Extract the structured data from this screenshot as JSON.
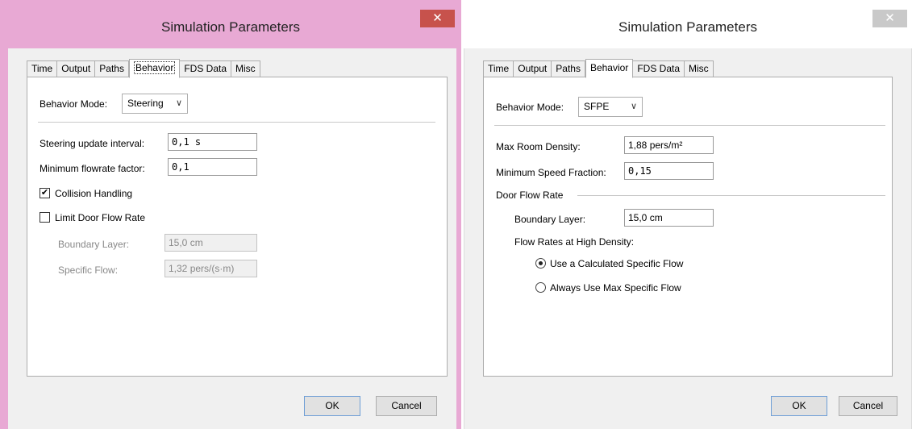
{
  "left_dialog": {
    "title": "Simulation Parameters",
    "close_glyph": "✕",
    "tabs": [
      "Time",
      "Output",
      "Paths",
      "Behavior",
      "FDS Data",
      "Misc"
    ],
    "active_tab": "Behavior",
    "behavior_mode_label": "Behavior Mode:",
    "behavior_mode_value": "Steering",
    "steering_interval_label": "Steering update interval:",
    "steering_interval_value": "0,1 s",
    "min_flowrate_label": "Minimum flowrate factor:",
    "min_flowrate_value": "0,1",
    "collision_label": "Collision Handling",
    "collision_checked": true,
    "limit_door_label": "Limit Door Flow Rate",
    "limit_door_checked": false,
    "boundary_label": "Boundary Layer:",
    "boundary_value": "15,0 cm",
    "specific_flow_label": "Specific Flow:",
    "specific_flow_value": "1,32 pers/(s·m)",
    "ok_label": "OK",
    "cancel_label": "Cancel"
  },
  "right_dialog": {
    "title": "Simulation Parameters",
    "close_glyph": "✕",
    "tabs": [
      "Time",
      "Output",
      "Paths",
      "Behavior",
      "FDS Data",
      "Misc"
    ],
    "active_tab": "Behavior",
    "behavior_mode_label": "Behavior Mode:",
    "behavior_mode_value": "SFPE",
    "max_density_label": "Max Room Density:",
    "max_density_value": "1,88 pers/m²",
    "min_speed_label": "Minimum Speed Fraction:",
    "min_speed_value": "0,15",
    "door_flow_group": "Door Flow Rate",
    "boundary_label": "Boundary Layer:",
    "boundary_value": "15,0 cm",
    "flow_rates_label": "Flow Rates at High Density:",
    "radio_calculated_label": "Use a Calculated Specific Flow",
    "radio_calculated_selected": true,
    "radio_max_label": "Always Use Max Specific Flow",
    "radio_max_selected": false,
    "ok_label": "OK",
    "cancel_label": "Cancel"
  }
}
